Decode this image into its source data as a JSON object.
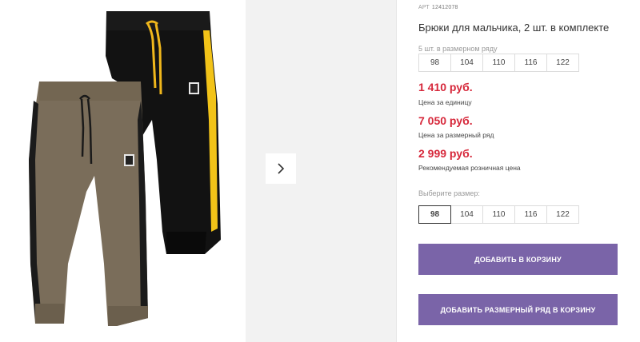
{
  "product": {
    "article_label": "АРТ",
    "article_value": "12412078",
    "title": "Брюки для мальчика, 2 шт. в комплекте"
  },
  "size_row": {
    "label": "5 шт. в размерном ряду",
    "sizes": [
      "98",
      "104",
      "110",
      "116",
      "122"
    ]
  },
  "prices": [
    {
      "value": "1 410 руб.",
      "note": "Цена за единицу"
    },
    {
      "value": "7 050 руб.",
      "note": "Цена за размерный ряд"
    },
    {
      "value": "2 999 руб.",
      "note": "Рекомендуемая розничная цена"
    }
  ],
  "size_select": {
    "label": "Выберите размер:",
    "sizes": [
      "98",
      "104",
      "110",
      "116",
      "122"
    ],
    "selected": "98"
  },
  "buttons": {
    "add_to_cart": "ДОБАВИТЬ В КОРЗИНУ",
    "add_row_to_cart": "ДОБАВИТЬ РАЗМЕРНЫЙ РЯД В КОРЗИНУ"
  },
  "icons": {
    "next": "chevron-right-icon"
  },
  "colors": {
    "price": "#d6273a",
    "button": "#7a64a8",
    "stripe_yellow": "#f2c318",
    "pants_black": "#0f0f0f",
    "pants_khaki": "#7a6d5a"
  }
}
